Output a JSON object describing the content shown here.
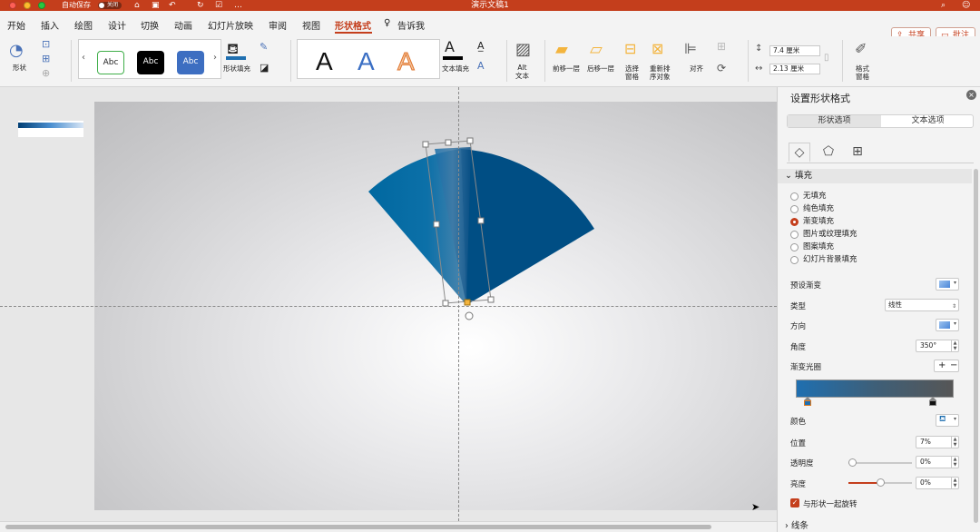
{
  "titlebar": {
    "autosave_label": "自动保存",
    "autosave_state": "关闭",
    "doc_title": "演示文稿1"
  },
  "tabs": [
    "开始",
    "插入",
    "绘图",
    "设计",
    "切换",
    "动画",
    "幻灯片放映",
    "审阅",
    "视图",
    "形状格式"
  ],
  "tell_me": "告诉我",
  "share_label": "共享",
  "comments_label": "批注",
  "ribbon": {
    "shape_label": "形状",
    "style_samples": [
      "Abc",
      "Abc",
      "Abc"
    ],
    "shape_fill_label": "形状填充",
    "wordart_sample": "A",
    "text_fill_label": "文本填充",
    "alt_text_label": "Alt\n文本",
    "bring_forward_label": "前移一层",
    "send_backward_label": "后移一层",
    "selection_pane_label": "选择\n窗格",
    "reorder_label": "重新排\n序对象",
    "align_label": "对齐",
    "height_value": "7.4 厘米",
    "width_value": "2.13 厘米",
    "format_pane_label": "格式\n窗格"
  },
  "pane": {
    "title": "设置形状格式",
    "tab_shape": "形状选项",
    "tab_text": "文本选项",
    "fill_section": "填充",
    "fill_options": [
      "无填充",
      "纯色填充",
      "渐变填充",
      "图片或纹理填充",
      "图案填充",
      "幻灯片背景填充"
    ],
    "fill_selected_index": 2,
    "preset_label": "预设渐变",
    "type_label": "类型",
    "type_value": "线性",
    "direction_label": "方向",
    "angle_label": "角度",
    "angle_value": "350°",
    "stops_label": "渐变光圈",
    "color_label": "颜色",
    "position_label": "位置",
    "position_value": "7%",
    "transparency_label": "透明度",
    "transparency_value": "0%",
    "transparency_level": 0,
    "brightness_label": "亮度",
    "brightness_value": "0%",
    "brightness_level": 0.5,
    "rotate_with_shape_label": "与形状一起旋转",
    "rotate_with_shape_checked": true,
    "line_section": "线条"
  },
  "colors": {
    "accent": "#c43e1c",
    "fan_main": "#004e84",
    "fan_left": "#0068a0",
    "stop_left": "#1f6fb0",
    "stop_right": "#565656"
  }
}
